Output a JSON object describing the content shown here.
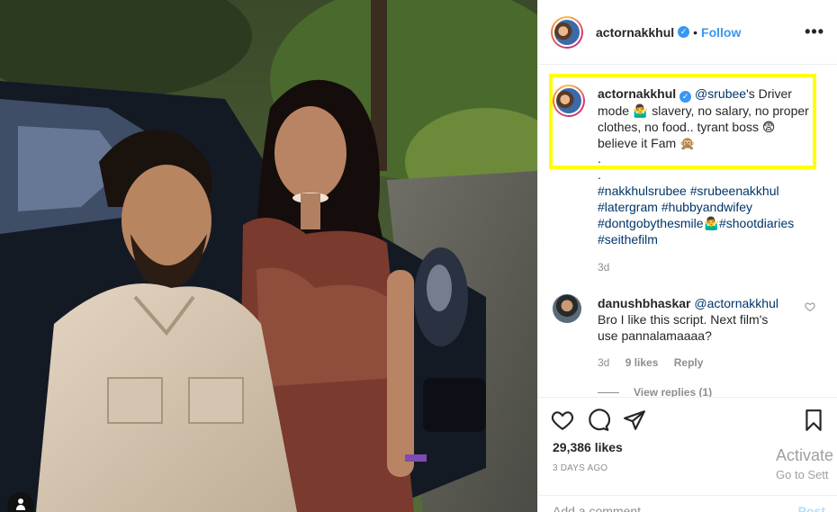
{
  "header": {
    "username": "actornakkhul",
    "verified_icon": "verified-badge-icon",
    "separator": "•",
    "follow_label": "Follow",
    "more_label": "•••"
  },
  "caption": {
    "username": "actornakkhul",
    "mention": "@srubee",
    "text_1": "'s Driver mode",
    "emoji_1": "🤷‍♂️",
    "text_2": " slavery, no salary, no proper clothes, no food.. tyrant boss",
    "emoji_2": "😨",
    "text_3": " believe it Fam",
    "emoji_3": "🙊",
    "dots": [
      ".",
      "."
    ],
    "hashtags": [
      "#nakkhulsrubee",
      "#srubeenakkhul",
      "#latergram",
      "#hubbyandwifey",
      "#dontgobythesmile🤷‍♂️#shootdiaries",
      "#seithefilm"
    ],
    "time": "3d"
  },
  "comment": {
    "username": "danushbhaskar",
    "mention": "@actornakkhul",
    "text": "Bro I like this script. Next film's use pannalamaaaa?",
    "time": "3d",
    "likes": "9 likes",
    "reply_label": "Reply",
    "view_replies": "View replies (1)"
  },
  "actions": {
    "likes_count": "29,386 likes",
    "date": "3 DAYS AGO",
    "comment_placeholder": "Add a comment...",
    "post_label": "Post"
  },
  "overlay": {
    "activate_line1": "Activate",
    "activate_line2": "Go to Sett"
  },
  "colors": {
    "highlight": "#ffff00",
    "link": "#3897f0",
    "hashtag": "#003569"
  }
}
